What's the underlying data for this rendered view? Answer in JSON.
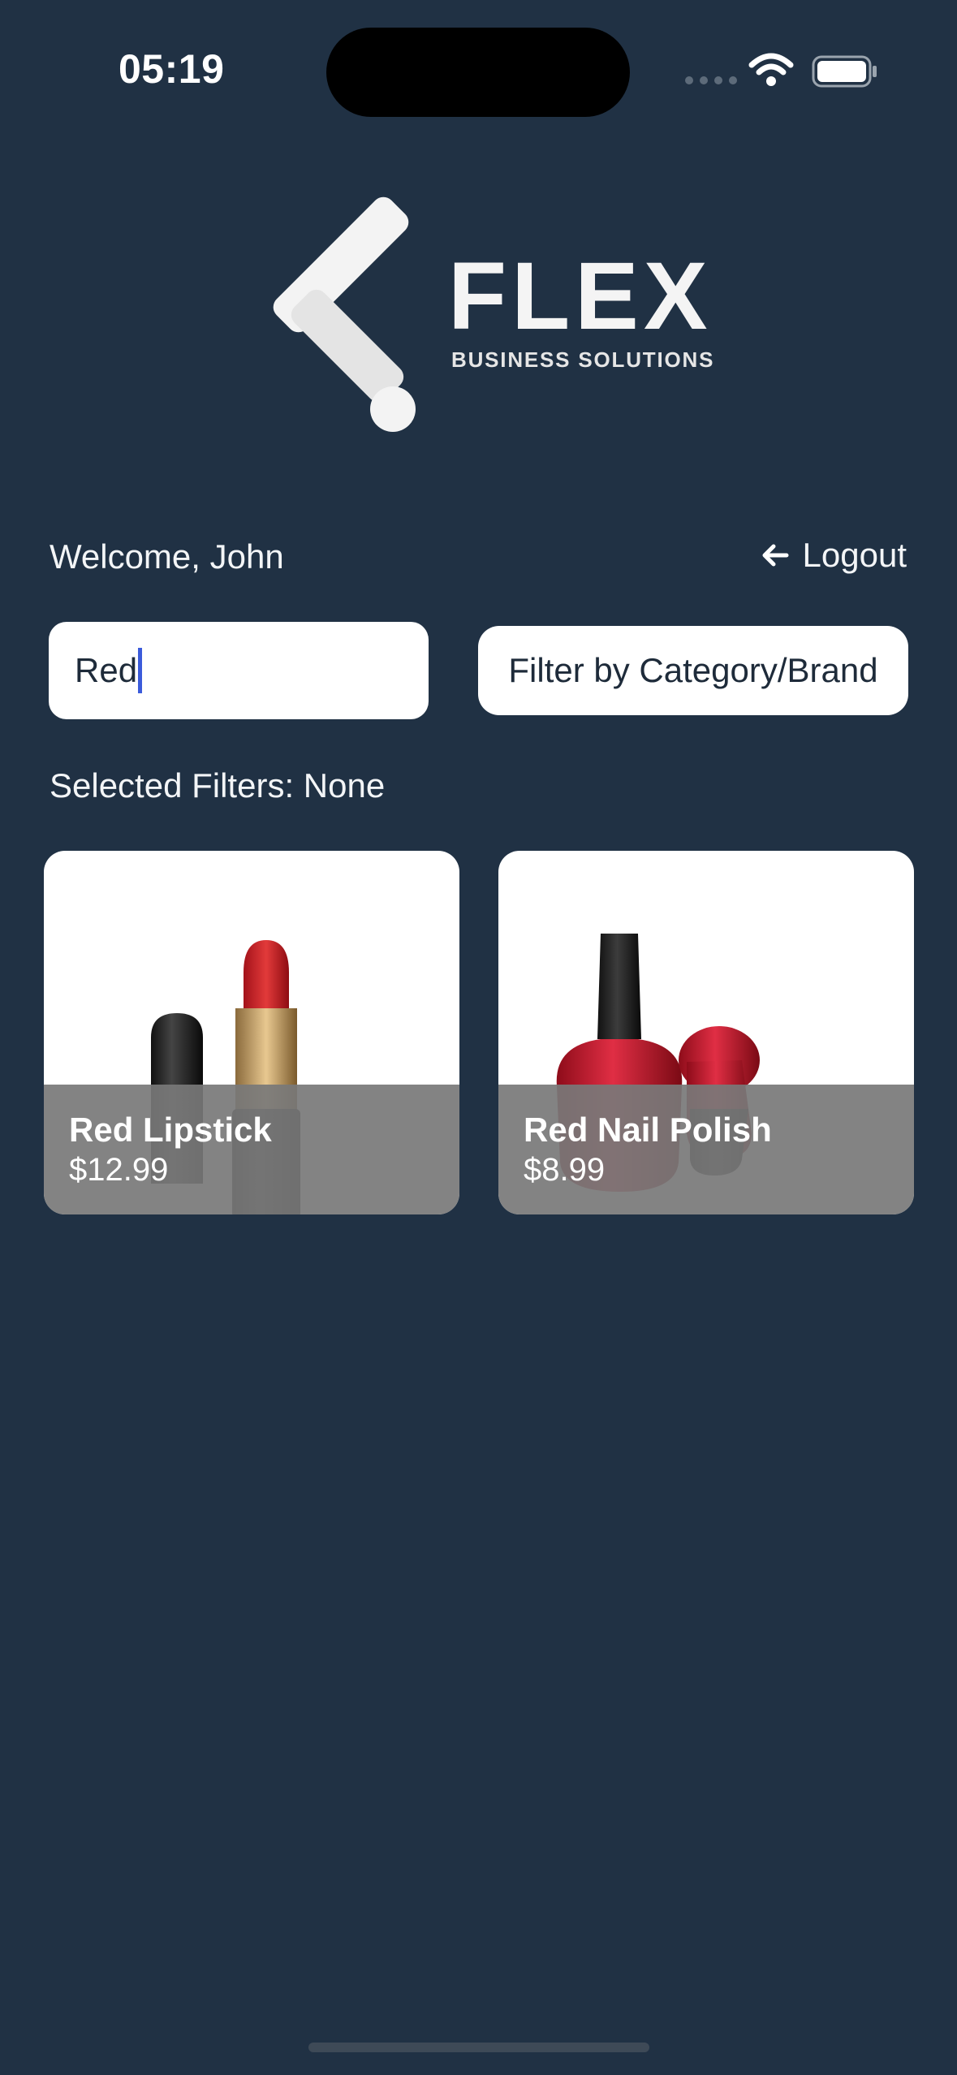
{
  "status_bar": {
    "time": "05:19"
  },
  "brand": {
    "name": "FLEX",
    "tagline": "BUSINESS SOLUTIONS"
  },
  "header": {
    "welcome": "Welcome, John",
    "logout_label": "Logout"
  },
  "search": {
    "value": "Red"
  },
  "filter": {
    "button_label": "Filter by Category/Brand",
    "selected_text": "Selected Filters: None"
  },
  "products": [
    {
      "name": "Red Lipstick",
      "price": "$12.99",
      "icon": "lipstick-image"
    },
    {
      "name": "Red Nail Polish",
      "price": "$8.99",
      "icon": "nail-polish-image"
    }
  ],
  "colors": {
    "background": "#203144",
    "accent_caret": "#3b5bdb",
    "card_overlay": "#787878"
  }
}
